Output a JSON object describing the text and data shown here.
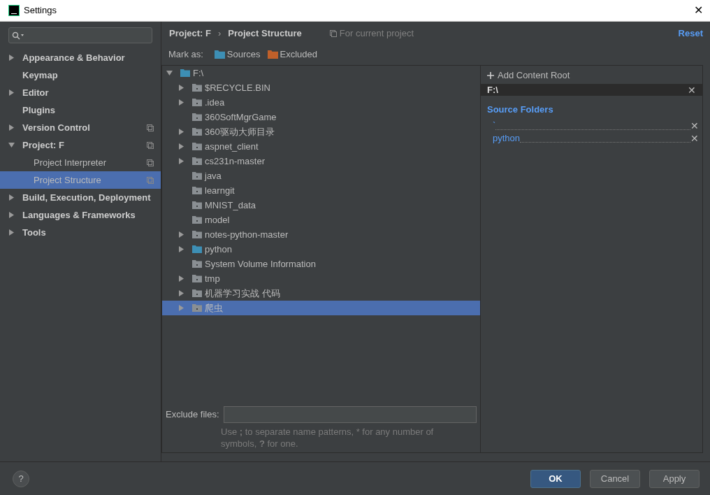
{
  "window": {
    "title": "Settings",
    "close": "✕"
  },
  "sidebar": {
    "items": [
      {
        "label": "Appearance & Behavior",
        "expandable": true,
        "expanded": false,
        "selected": false,
        "project_scoped": false
      },
      {
        "label": "Keymap",
        "expandable": false,
        "selected": false,
        "project_scoped": false
      },
      {
        "label": "Editor",
        "expandable": true,
        "expanded": false,
        "selected": false,
        "project_scoped": false
      },
      {
        "label": "Plugins",
        "expandable": false,
        "selected": false,
        "project_scoped": false
      },
      {
        "label": "Version Control",
        "expandable": true,
        "expanded": false,
        "selected": false,
        "project_scoped": true
      },
      {
        "label": "Project: F",
        "expandable": true,
        "expanded": true,
        "selected": false,
        "project_scoped": true,
        "children": [
          {
            "label": "Project Interpreter",
            "selected": false,
            "project_scoped": true
          },
          {
            "label": "Project Structure",
            "selected": true,
            "project_scoped": true
          }
        ]
      },
      {
        "label": "Build, Execution, Deployment",
        "expandable": true,
        "expanded": false,
        "selected": false,
        "project_scoped": false
      },
      {
        "label": "Languages & Frameworks",
        "expandable": true,
        "expanded": false,
        "selected": false,
        "project_scoped": false
      },
      {
        "label": "Tools",
        "expandable": true,
        "expanded": false,
        "selected": false,
        "project_scoped": false
      }
    ]
  },
  "breadcrumb": {
    "items": [
      "Project: F",
      "Project Structure"
    ],
    "separator": "›",
    "scope_note": "For current project"
  },
  "reset": "Reset",
  "mark_as": {
    "label": "Mark as:",
    "options": [
      {
        "label": "Sources",
        "color": "#3d8fb5"
      },
      {
        "label": "Excluded",
        "color": "#c0602a"
      }
    ]
  },
  "tree": {
    "name": "F:\\",
    "kind": "source",
    "expanded": true,
    "children": [
      {
        "name": "$RECYCLE.BIN",
        "kind": "plain",
        "expandable": true,
        "selected": false
      },
      {
        "name": ".idea",
        "kind": "plain",
        "expandable": true,
        "selected": false
      },
      {
        "name": "360SoftMgrGame",
        "kind": "plain",
        "expandable": false,
        "selected": false
      },
      {
        "name": "360驱动大师目录",
        "kind": "plain",
        "expandable": true,
        "selected": false
      },
      {
        "name": "aspnet_client",
        "kind": "plain",
        "expandable": true,
        "selected": false
      },
      {
        "name": "cs231n-master",
        "kind": "plain",
        "expandable": true,
        "selected": false
      },
      {
        "name": "java",
        "kind": "plain",
        "expandable": false,
        "selected": false
      },
      {
        "name": "learngit",
        "kind": "plain",
        "expandable": false,
        "selected": false
      },
      {
        "name": "MNIST_data",
        "kind": "plain",
        "expandable": false,
        "selected": false
      },
      {
        "name": "model",
        "kind": "plain",
        "expandable": false,
        "selected": false
      },
      {
        "name": "notes-python-master",
        "kind": "plain",
        "expandable": true,
        "selected": false
      },
      {
        "name": "python",
        "kind": "source",
        "expandable": true,
        "selected": false
      },
      {
        "name": "System Volume Information",
        "kind": "plain",
        "expandable": false,
        "selected": false
      },
      {
        "name": "tmp",
        "kind": "plain",
        "expandable": true,
        "selected": false
      },
      {
        "name": "机器学习实战 代码",
        "kind": "plain",
        "expandable": true,
        "selected": false
      },
      {
        "name": "爬虫",
        "kind": "plain",
        "expandable": true,
        "selected": true
      }
    ]
  },
  "exclude_files": {
    "label": "Exclude files:",
    "hint": "Use **;** to separate name patterns, * for any number of symbols, **?** for one."
  },
  "content_root": {
    "add": "Add Content Root",
    "root": "F:\\",
    "section": "Source Folders",
    "folders": [
      "`",
      "python"
    ]
  },
  "buttons": [
    {
      "label": "OK",
      "default": true
    },
    {
      "label": "Cancel",
      "default": false
    },
    {
      "label": "Apply",
      "default": false
    }
  ],
  "help": "?"
}
